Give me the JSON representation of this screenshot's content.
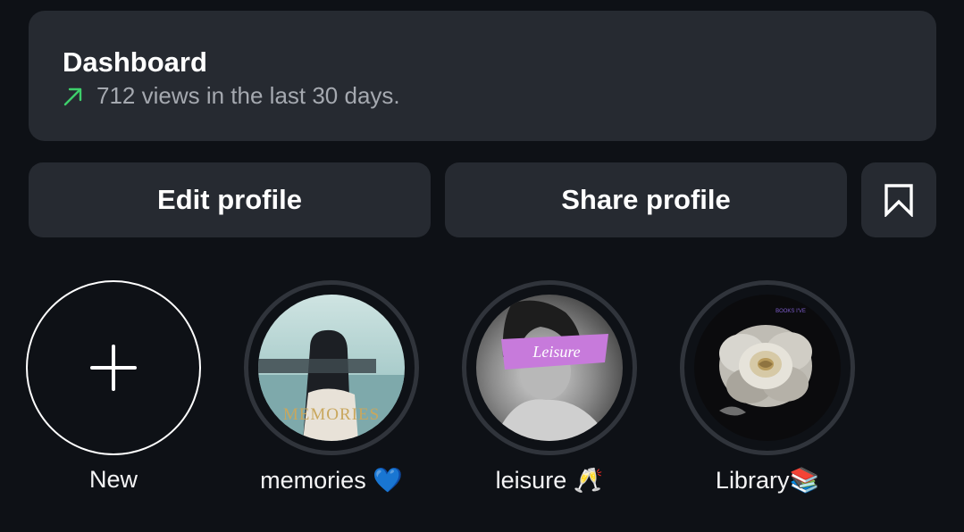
{
  "dashboard": {
    "title": "Dashboard",
    "stats": "712 views in the last 30 days."
  },
  "buttons": {
    "edit_profile": "Edit profile",
    "share_profile": "Share profile"
  },
  "highlights": [
    {
      "label": "New"
    },
    {
      "label": "memories 💙",
      "cover_text": "MEMORIES"
    },
    {
      "label": "leisure 🥂",
      "cover_text": "Leisure"
    },
    {
      "label": "Library📚",
      "cover_text": "BOOKS I'VE"
    }
  ],
  "colors": {
    "background": "#0e1116",
    "card": "#262a31",
    "trend_green": "#3ecf6b",
    "muted_text": "#a5a9b0"
  }
}
